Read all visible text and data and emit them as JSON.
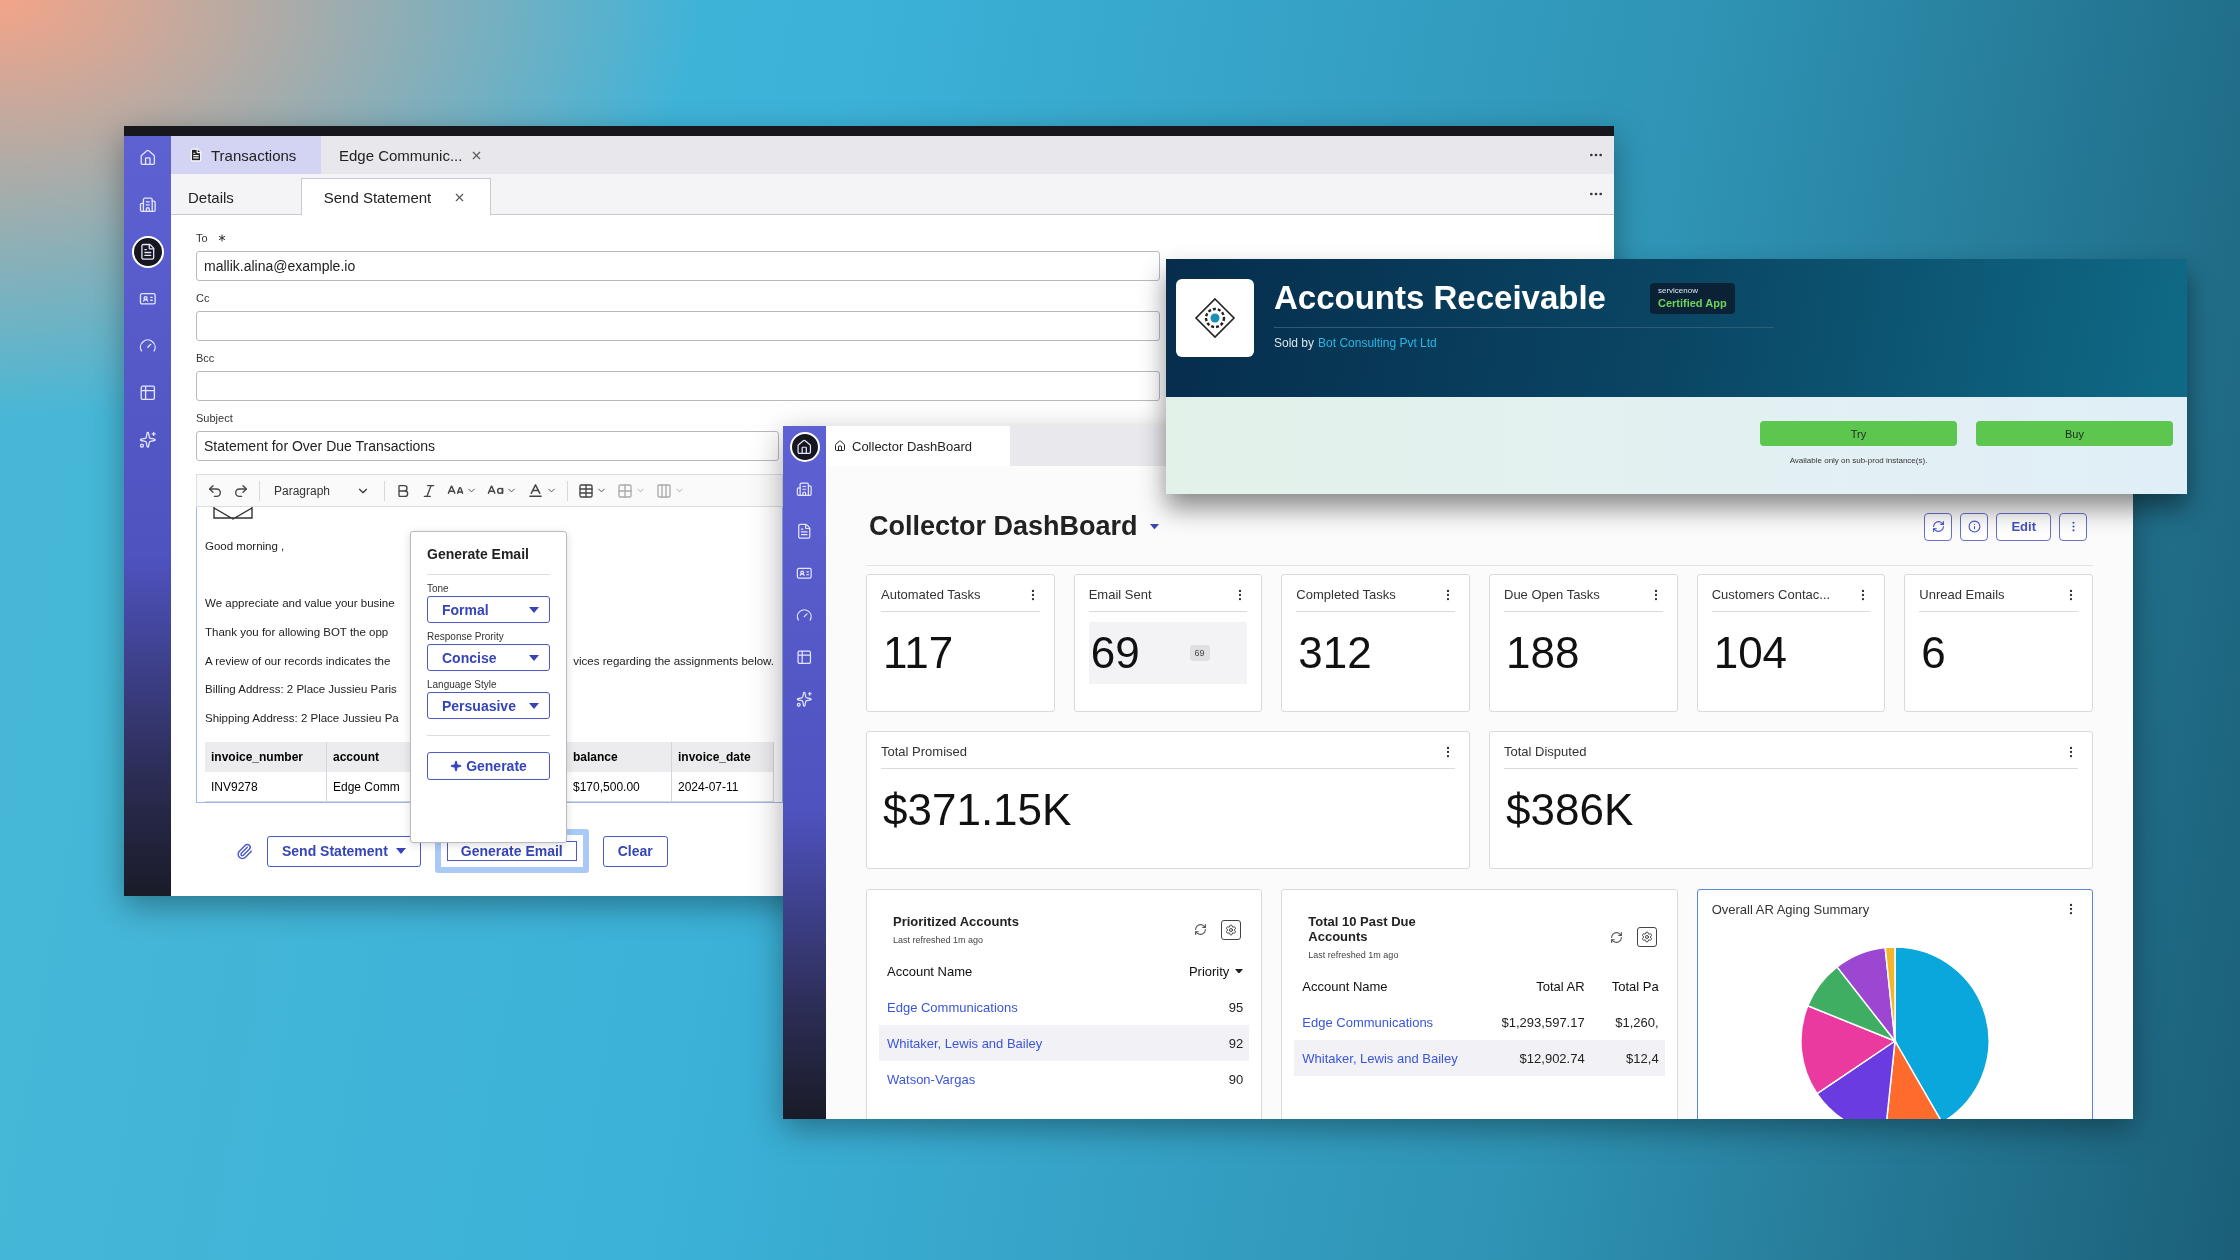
{
  "email_window": {
    "sidebar": [
      {
        "kind": "home",
        "selected": false
      },
      {
        "kind": "building",
        "selected": false
      },
      {
        "kind": "document",
        "selected": true
      },
      {
        "kind": "contact",
        "selected": false
      },
      {
        "kind": "gauge",
        "selected": false
      },
      {
        "kind": "table",
        "selected": false
      },
      {
        "kind": "sparkle",
        "selected": false
      }
    ],
    "tabs": [
      {
        "label": "Transactions",
        "selected": true,
        "closable": false
      },
      {
        "label": "Edge Communic...",
        "selected": false,
        "closable": true
      }
    ],
    "subtabs": [
      {
        "label": "Details",
        "selected": false,
        "closable": false
      },
      {
        "label": "Send Statement",
        "selected": true,
        "closable": true
      }
    ],
    "fields": [
      {
        "label": "To",
        "required": true,
        "value": "mallik.alina@example.io"
      },
      {
        "label": "Cc",
        "required": false
      },
      {
        "label": "Bcc",
        "required": false
      },
      {
        "label": "Subject",
        "required": false,
        "value": "Statement for Over Due Transactions"
      }
    ],
    "block_format": "Paragraph",
    "body": {
      "greeting": "Good morning ,",
      "lines": [
        {
          "text": "We appreciate and value your busine"
        },
        {
          "text": "Thank you for allowing BOT the opp"
        },
        {
          "text": "A review of our records indicates the",
          "tail": "vices regarding the assignments below."
        },
        {
          "text": "Billing Address: 2 Place Jussieu Paris"
        },
        {
          "text": "Shipping Address: 2 Place Jussieu Pa"
        }
      ]
    },
    "invoice_table": {
      "columns": [
        "invoice_number",
        "account",
        "balance",
        "invoice_date"
      ],
      "rows": [
        [
          "INV9278",
          "Edge Comm",
          "$170,500.00",
          "2024-07-11"
        ]
      ]
    },
    "generate_popup": {
      "title": "Generate Email",
      "options": [
        {
          "label": "Tone",
          "value": "Formal"
        },
        {
          "label": "Response Prority",
          "value": "Concise"
        },
        {
          "label": "Language Style",
          "value": "Persuasive"
        }
      ],
      "button": "Generate"
    },
    "actions": [
      {
        "label": "Send Statement",
        "kind": "menu",
        "focused": false
      },
      {
        "label": "Generate Email",
        "kind": "button",
        "focused": true
      },
      {
        "label": "Clear",
        "kind": "button",
        "focused": false
      }
    ]
  },
  "listing": {
    "title": "Accounts Receivable",
    "badge_caption": "servicenow",
    "badge": "Certified App",
    "sold_by": "Sold by",
    "vendor": "Bot Consulting Pvt Ltd",
    "buttons": [
      "Try",
      "Buy"
    ],
    "note": "Available only on sub-prod instance(s)."
  },
  "dashboard_window": {
    "sidebar": [
      {
        "kind": "home",
        "selected": true
      },
      {
        "kind": "building",
        "selected": false
      },
      {
        "kind": "document",
        "selected": false
      },
      {
        "kind": "contact",
        "selected": false
      },
      {
        "kind": "gauge",
        "selected": false
      },
      {
        "kind": "table",
        "selected": false
      },
      {
        "kind": "sparkle",
        "selected": false
      }
    ],
    "tab": "Collector DashBoard",
    "title": "Collector DashBoard",
    "header_buttons": [
      {
        "kind": "refresh"
      },
      {
        "kind": "info"
      },
      {
        "kind": "text",
        "label": "Edit"
      },
      {
        "kind": "more"
      }
    ],
    "metrics": [
      {
        "title": "Automated Tasks",
        "value": "117",
        "hovered": false
      },
      {
        "title": "Email Sent",
        "value": "69",
        "hovered": true,
        "tooltip": "69"
      },
      {
        "title": "Completed Tasks",
        "value": "312",
        "hovered": false
      },
      {
        "title": "Due Open Tasks",
        "value": "188",
        "hovered": false
      },
      {
        "title": "Customers Contac...",
        "value": "104",
        "hovered": false
      },
      {
        "title": "Unread Emails",
        "value": "6",
        "hovered": false
      }
    ],
    "totals": [
      {
        "title": "Total Promised",
        "value": "$371.15K"
      },
      {
        "title": "Total Disputed",
        "value": "$386K"
      }
    ],
    "widgets": [
      {
        "kind": "table",
        "title": "Prioritized Accounts",
        "refreshed": "Last refreshed 1m ago",
        "focused": false,
        "columns": [
          {
            "label": "Account Name",
            "sorted": false
          },
          {
            "label": "Priority",
            "sorted": true
          }
        ],
        "rows": [
          {
            "cells": [
              "Edge Communications",
              "95"
            ],
            "hovered": false
          },
          {
            "cells": [
              "Whitaker, Lewis and Bailey",
              "92"
            ],
            "hovered": true
          },
          {
            "cells": [
              "Watson-Vargas",
              "90"
            ],
            "hovered": false
          }
        ]
      },
      {
        "kind": "table",
        "title": "Total 10 Past Due Accounts",
        "refreshed": "Last refreshed 1m ago",
        "focused": false,
        "columns": [
          {
            "label": "Account Name",
            "sorted": false
          },
          {
            "label": "Total AR",
            "sorted": false
          },
          {
            "label": "Total Pa",
            "sorted": false
          }
        ],
        "rows": [
          {
            "cells": [
              "Edge Communications",
              "$1,293,597.17",
              "$1,260,"
            ],
            "hovered": false
          },
          {
            "cells": [
              "Whitaker, Lewis and Bailey",
              "$12,902.74",
              "$12,4"
            ],
            "hovered": true
          }
        ]
      },
      {
        "kind": "chart",
        "title": "Overall AR Aging Summary",
        "focused": true
      }
    ]
  }
}
